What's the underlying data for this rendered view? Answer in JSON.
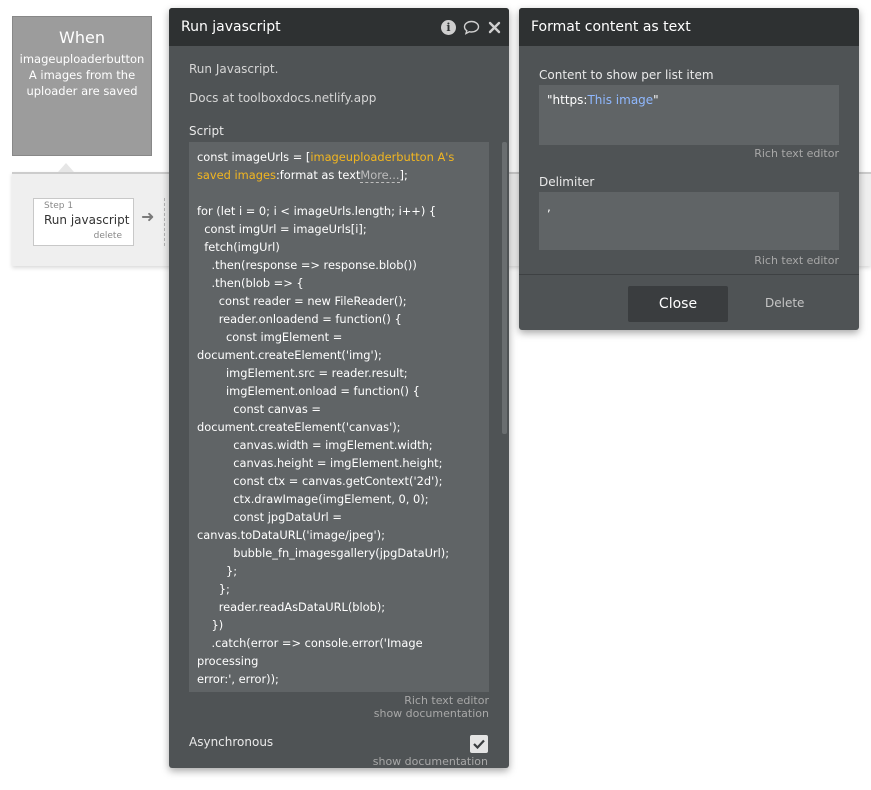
{
  "workflow": {
    "event_title": "When",
    "event_description": "imageuploaderbutton A images from the uploader are saved",
    "step": {
      "number_label": "Step 1",
      "action_label": "Run javascript",
      "delete_label": "delete"
    }
  },
  "run_js_panel": {
    "title": "Run javascript",
    "header_icons": [
      "info-icon",
      "comment-icon",
      "close-icon"
    ],
    "description_line1": "Run Javascript.",
    "description_line2": "Docs at toolboxdocs.netlify.app",
    "script_label": "Script",
    "script": {
      "prefix": "const imageUrls = [",
      "dynamic_source": "imageuploaderbutton A's saved images",
      "dynamic_operator": ":format as text",
      "more_chip": "More...",
      "line1_suffix": "];",
      "body": "for (let i = 0; i < imageUrls.length; i++) {\n  const imgUrl = imageUrls[i];\n  fetch(imgUrl)\n    .then(response => response.blob())\n    .then(blob => {\n      const reader = new FileReader();\n      reader.onloadend = function() {\n        const imgElement =\ndocument.createElement('img');\n        imgElement.src = reader.result;\n        imgElement.onload = function() {\n          const canvas =\ndocument.createElement('canvas');\n          canvas.width = imgElement.width;\n          canvas.height = imgElement.height;\n          const ctx = canvas.getContext('2d');\n          ctx.drawImage(imgElement, 0, 0);\n          const jpgDataUrl =\ncanvas.toDataURL('image/jpeg');\n          bubble_fn_imagesgallery(jpgDataUrl);\n        };\n      };\n      reader.readAsDataURL(blob);\n    })\n    .catch(error => console.error('Image processing\nerror:', error));\n}"
    },
    "rich_text_editor_link": "Rich text editor",
    "show_documentation_link": "show documentation",
    "asynchronous_label": "Asynchronous",
    "asynchronous_checked": true,
    "show_documentation_link_2": "show documentation"
  },
  "format_panel": {
    "title": "Format content as text",
    "content_label": "Content to show per list item",
    "content_value_prefix": "\"https:",
    "content_value_dynamic": "This image",
    "content_value_suffix": "\"",
    "content_rich_text_link": "Rich text editor",
    "delimiter_label": "Delimiter",
    "delimiter_value": ",",
    "delimiter_rich_text_link": "Rich text editor",
    "close_button": "Close",
    "delete_button": "Delete"
  },
  "colors": {
    "panel_bg": "#4f5355",
    "panel_header_bg": "#2e3132",
    "input_bg": "#606466",
    "dynamic_expression": "#f2b620",
    "dynamic_link": "#8fb8ff",
    "event_card_bg": "#9c9c9c"
  }
}
